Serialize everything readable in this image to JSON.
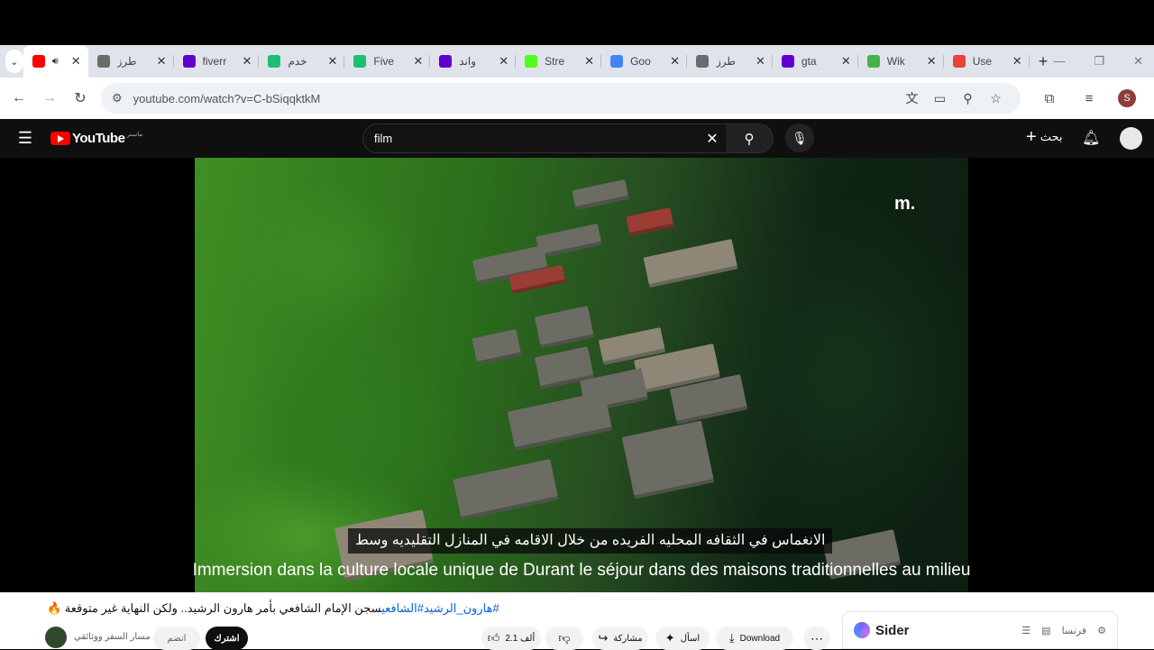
{
  "browser": {
    "tabs": [
      {
        "title": "",
        "icon": "youtube-icon",
        "color": "#ff0000",
        "active": true
      },
      {
        "title": "طرز",
        "icon": "chatgpt-icon",
        "color": "#6b6b6b"
      },
      {
        "title": "fiverr",
        "icon": "yahoo-icon",
        "color": "#6001d2"
      },
      {
        "title": "خدم",
        "icon": "fiverr-icon",
        "color": "#1dbf73"
      },
      {
        "title": "Five",
        "icon": "fiverr-icon",
        "color": "#1dbf73"
      },
      {
        "title": "واند",
        "icon": "yahoo-icon",
        "color": "#6001d2"
      },
      {
        "title": "Stre",
        "icon": "kick-icon",
        "color": "#53fc18"
      },
      {
        "title": "Goo",
        "icon": "google-icon",
        "color": "#4285f4"
      },
      {
        "title": "طرز",
        "icon": "chatgpt-icon",
        "color": "#6b6b6b"
      },
      {
        "title": "gta",
        "icon": "yahoo-icon",
        "color": "#6001d2"
      },
      {
        "title": "Wik",
        "icon": "leaf-icon",
        "color": "#48b04a"
      },
      {
        "title": "Use",
        "icon": "gmail-icon",
        "color": "#ea4335"
      }
    ],
    "url": "youtube.com/watch?v=C-bSiqqktkM",
    "profile_initial": "S"
  },
  "youtube": {
    "search_query": "film",
    "create_label": "بحث",
    "logo_text": "YouTube",
    "logo_country": "ماستر"
  },
  "video": {
    "watermark": "m.",
    "subtitle_ar": "الانغماس في الثقافه المحليه الفريده من خلال الاقامه في المنازل التقليديه وسط",
    "subtitle_fr": "Immersion dans la culture locale unique de Durant le séjour dans des maisons traditionnelles au milieu"
  },
  "below": {
    "title_tags": "#هارون_الرشيد#الشافعي",
    "title_text": "سجن الإمام الشافعي بأمر هارون الرشيد.. ولكن النهاية غير متوقعة 🔥",
    "channel": "مسار السفر ووثائقي",
    "join_label": "انضم",
    "subscribe_label": "اشترك",
    "likes": "2.1 ألف",
    "share_label": "مشاركة",
    "ask_label": "اسأل",
    "download_label": "Download"
  },
  "sider": {
    "name": "Sider",
    "lang": "فرنسا"
  }
}
